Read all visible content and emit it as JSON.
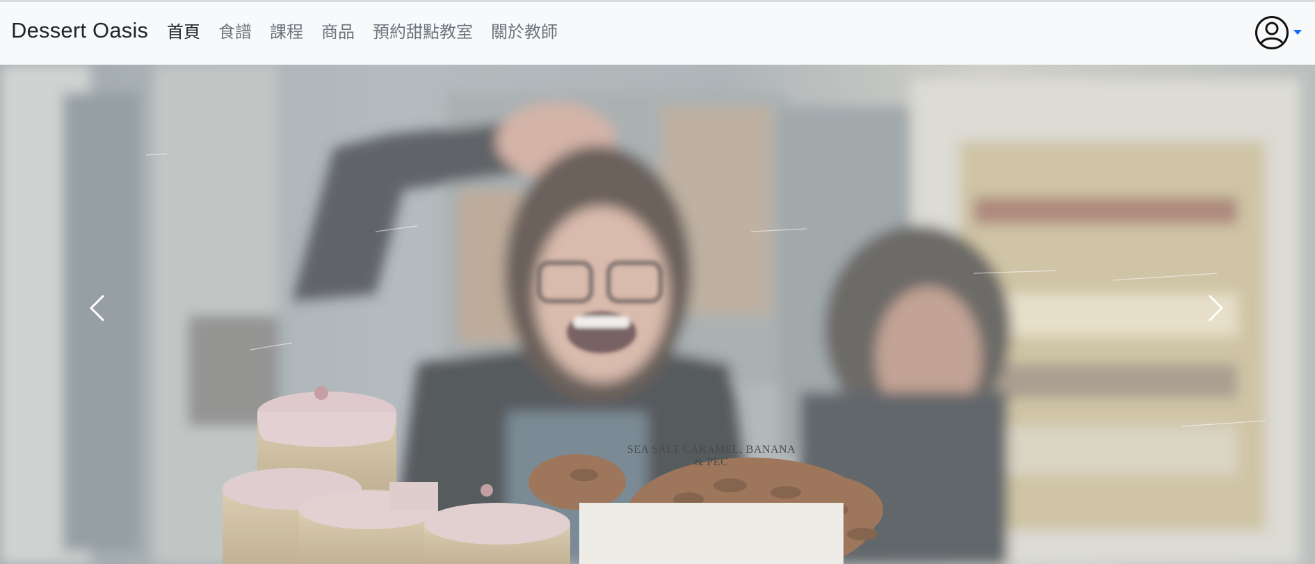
{
  "navbar": {
    "brand": "Dessert Oasis",
    "links": [
      {
        "label": "首頁",
        "active": true
      },
      {
        "label": "食譜",
        "active": false
      },
      {
        "label": "課程",
        "active": false
      },
      {
        "label": "商品",
        "active": false
      },
      {
        "label": "預約甜點教室",
        "active": false
      },
      {
        "label": "關於教師",
        "active": false
      }
    ],
    "user_icon": "user-circle-icon",
    "dropdown_icon": "caret-down-icon"
  },
  "carousel": {
    "slide_description": "Bakery photo: smiling woman behind a display of pink-iced cakes and pecans",
    "sign_text_line1": "SEA SALT CARAMEL, BANANA",
    "sign_text_line2": "& PEC",
    "prev_icon": "chevron-left-icon",
    "next_icon": "chevron-right-icon"
  },
  "colors": {
    "navbar_bg": "#f8f9fa",
    "brand_text": "#212529",
    "link_muted": "#6c757d",
    "accent": "#0d6efd"
  }
}
